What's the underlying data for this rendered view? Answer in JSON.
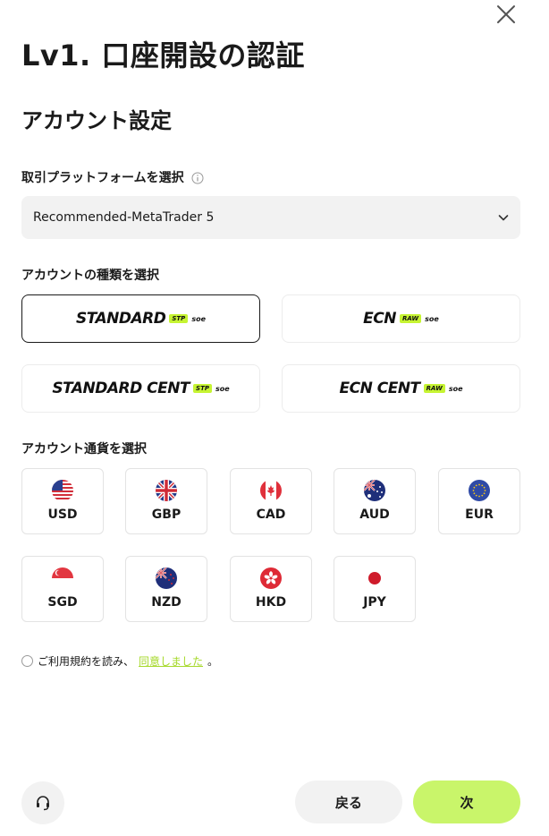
{
  "header": {
    "title": "Lv1. 口座開設の認証",
    "close_icon": "close-icon"
  },
  "section": {
    "title": "アカウント設定"
  },
  "platform": {
    "label": "取引プラットフォームを選択",
    "info_icon": "info-icon",
    "selected": "Recommended-MetaTrader 5",
    "chevron_icon": "chevron-down-icon"
  },
  "account_type": {
    "label": "アカウントの種類を選択",
    "selected": "STANDARD",
    "options": [
      {
        "name": "STANDARD",
        "tag": "STP",
        "suffix": "soe"
      },
      {
        "name": "ECN",
        "tag": "RAW",
        "suffix": "soe"
      },
      {
        "name": "STANDARD CENT",
        "tag": "STP",
        "suffix": "soe"
      },
      {
        "name": "ECN CENT",
        "tag": "RAW",
        "suffix": "soe"
      }
    ],
    "tag_color": "#c6f432"
  },
  "currency": {
    "label": "アカウント通貨を選択",
    "options": [
      {
        "code": "USD",
        "flag": "us-flag-icon"
      },
      {
        "code": "GBP",
        "flag": "uk-flag-icon"
      },
      {
        "code": "CAD",
        "flag": "canada-flag-icon"
      },
      {
        "code": "AUD",
        "flag": "australia-flag-icon"
      },
      {
        "code": "EUR",
        "flag": "eu-flag-icon"
      },
      {
        "code": "SGD",
        "flag": "singapore-flag-icon"
      },
      {
        "code": "NZD",
        "flag": "new-zealand-flag-icon"
      },
      {
        "code": "HKD",
        "flag": "hong-kong-flag-icon"
      },
      {
        "code": "JPY",
        "flag": "japan-flag-icon"
      }
    ]
  },
  "agreement": {
    "prefix": "ご利用規約を読み、",
    "link": "同意しました",
    "suffix": "。",
    "checked": false
  },
  "footer": {
    "support_icon": "headset-icon",
    "back_label": "戻る",
    "next_label": "次",
    "accent_color": "#c9f56a"
  }
}
